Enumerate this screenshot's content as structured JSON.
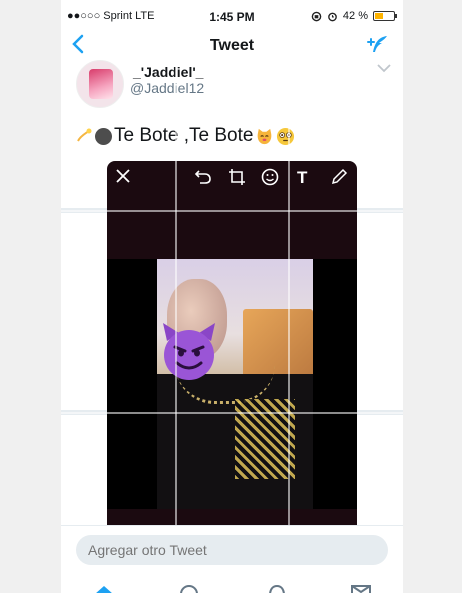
{
  "status_bar": {
    "carrier": "●●○○○ Sprint  LTE",
    "time": "1:45 PM",
    "battery_text": "42 %",
    "battery_level": 0.42
  },
  "nav": {
    "title": "Tweet",
    "back_icon": "chevron-left-icon",
    "compose_icon": "compose-feather-icon"
  },
  "tweet": {
    "username": "_'Jaddiel'_",
    "handle": "@Jaddiel12",
    "text": "Te Bote ,Te Bote"
  },
  "editor": {
    "tools": [
      "close-icon",
      "undo-icon",
      "crop-icon",
      "sticker-icon",
      "text-icon",
      "pencil-icon"
    ],
    "text_tool_label": "T"
  },
  "reply": {
    "placeholder": "Agregar otro Tweet"
  },
  "colors": {
    "accent": "#1da1f2",
    "editor_bg": "#1b0a10",
    "input_bg": "#e6ecf0"
  }
}
